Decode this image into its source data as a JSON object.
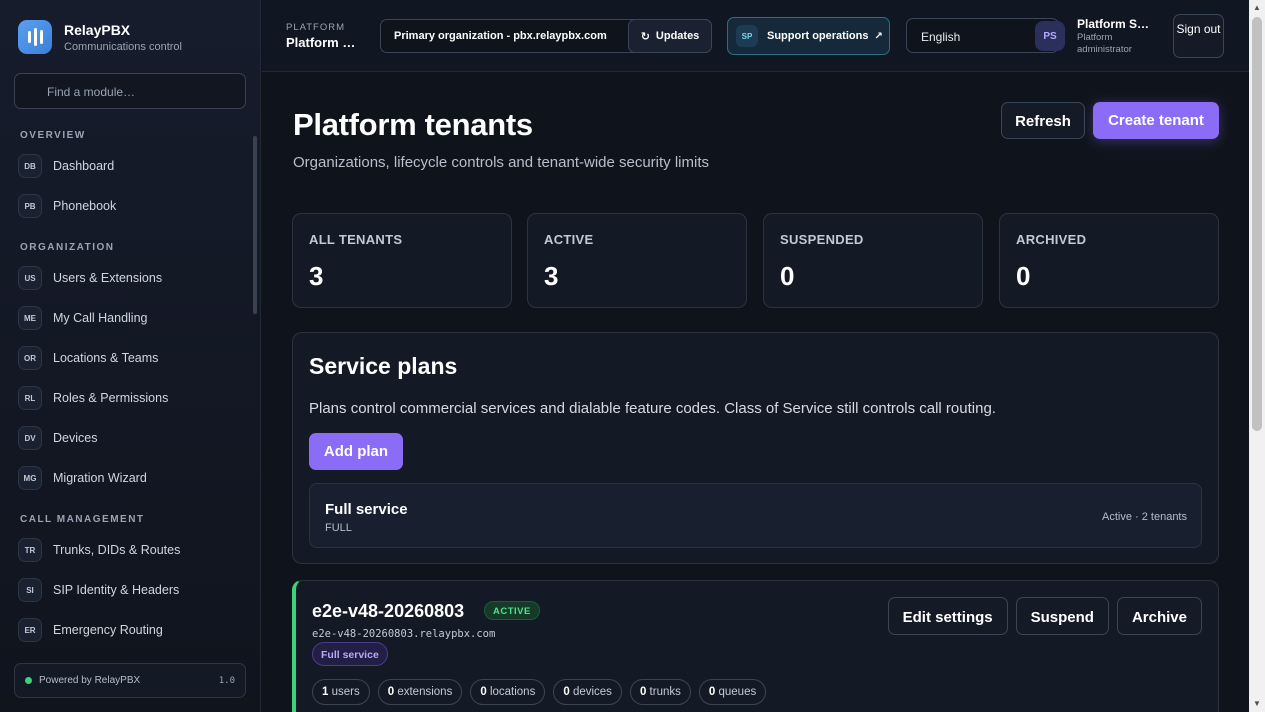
{
  "brand": {
    "name": "RelayPBX",
    "subtitle": "Communications control"
  },
  "sidebar": {
    "search_placeholder": "Find a module…",
    "sections": [
      {
        "title": "OVERVIEW",
        "items": [
          {
            "abbr": "DB",
            "label": "Dashboard"
          },
          {
            "abbr": "PB",
            "label": "Phonebook"
          }
        ]
      },
      {
        "title": "ORGANIZATION",
        "items": [
          {
            "abbr": "US",
            "label": "Users & Extensions"
          },
          {
            "abbr": "ME",
            "label": "My Call Handling"
          },
          {
            "abbr": "OR",
            "label": "Locations & Teams"
          },
          {
            "abbr": "RL",
            "label": "Roles & Permissions"
          },
          {
            "abbr": "DV",
            "label": "Devices"
          },
          {
            "abbr": "MG",
            "label": "Migration Wizard"
          }
        ]
      },
      {
        "title": "CALL MANAGEMENT",
        "items": [
          {
            "abbr": "TR",
            "label": "Trunks, DIDs & Routes"
          },
          {
            "abbr": "SI",
            "label": "SIP Identity & Headers"
          },
          {
            "abbr": "ER",
            "label": "Emergency Routing"
          }
        ]
      }
    ],
    "powered_by": "Powered by RelayPBX",
    "version": "1.0"
  },
  "topbar": {
    "kicker": "PLATFORM",
    "title": "Platform …",
    "org_select": "Primary organization - pbx.relaypbx.com",
    "updates_label": "Updates",
    "support_abbr": "SP",
    "support_label": "Support operations",
    "language": "English",
    "avatar_initials": "PS",
    "user_name": "Platform S…",
    "user_role": "Platform administrator",
    "signout_label": "Sign out"
  },
  "page": {
    "title": "Platform tenants",
    "subtitle": "Organizations, lifecycle controls and tenant-wide security limits",
    "refresh_label": "Refresh",
    "create_label": "Create tenant"
  },
  "stats": [
    {
      "label": "ALL TENANTS",
      "value": "3"
    },
    {
      "label": "ACTIVE",
      "value": "3"
    },
    {
      "label": "SUSPENDED",
      "value": "0"
    },
    {
      "label": "ARCHIVED",
      "value": "0"
    }
  ],
  "plans": {
    "title": "Service plans",
    "description": "Plans control commercial services and dialable feature codes. Class of Service still controls call routing.",
    "add_label": "Add plan",
    "items": [
      {
        "name": "Full service",
        "code": "FULL",
        "meta": "Active · 2 tenants"
      }
    ]
  },
  "tenant": {
    "name": "e2e-v48-20260803",
    "status": "ACTIVE",
    "domain": "e2e-v48-20260803.relaypbx.com",
    "plan": "Full service",
    "actions": [
      "Edit settings",
      "Suspend",
      "Archive"
    ],
    "counts": [
      {
        "n": "1",
        "label": "users"
      },
      {
        "n": "0",
        "label": "extensions"
      },
      {
        "n": "0",
        "label": "locations"
      },
      {
        "n": "0",
        "label": "devices"
      },
      {
        "n": "0",
        "label": "trunks"
      },
      {
        "n": "0",
        "label": "queues"
      }
    ]
  },
  "colors": {
    "accent": "#8b6cf6",
    "active_green": "#3ed07a",
    "background": "#0f141c"
  }
}
